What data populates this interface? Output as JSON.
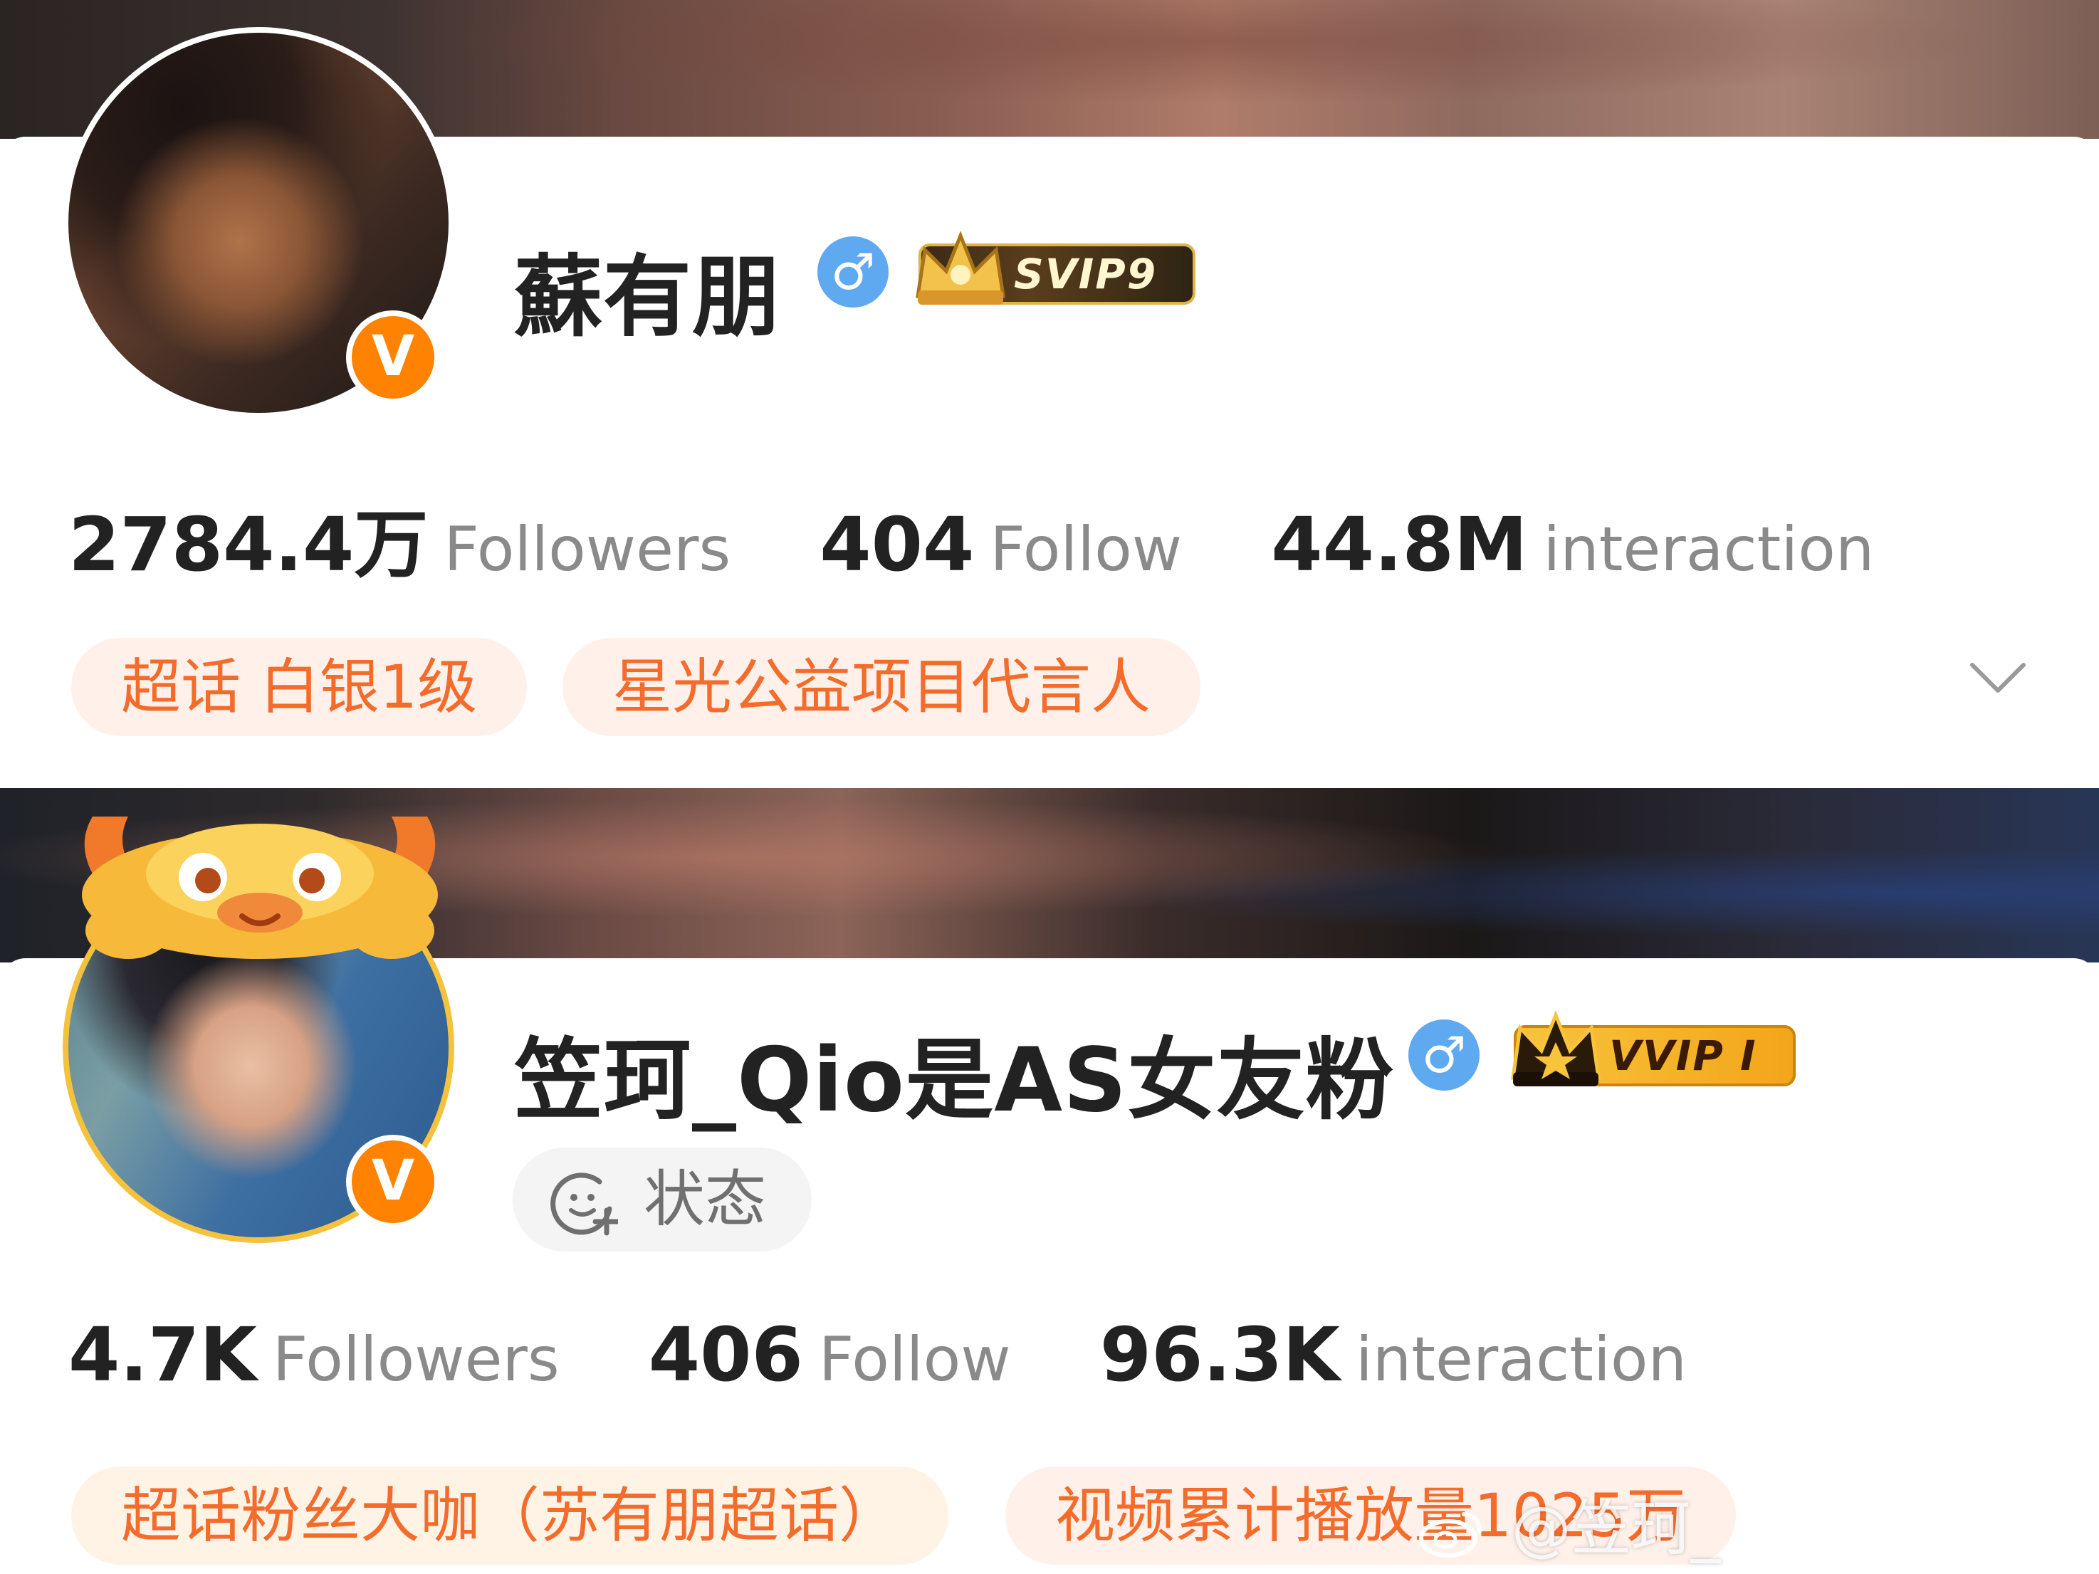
{
  "profiles": [
    {
      "name": "蘇有朋",
      "gender_symbol": "♂",
      "vip_label": "SVIP9",
      "verified_badge": "V",
      "stats": [
        {
          "value": "2784.4万",
          "label": "Followers"
        },
        {
          "value": "404",
          "label": "Follow"
        },
        {
          "value": "44.8M",
          "label": "interaction"
        }
      ],
      "tags": [
        "超话 白银1级",
        "星光公益项目代言人"
      ]
    },
    {
      "name": "笠珂_Qio是AS女友粉",
      "gender_symbol": "♂",
      "vip_label": "VVIP I",
      "verified_badge": "V",
      "status_label": "状态",
      "stats": [
        {
          "value": "4.7K",
          "label": "Followers"
        },
        {
          "value": "406",
          "label": "Follow"
        },
        {
          "value": "96.3K",
          "label": "interaction"
        }
      ],
      "tags": [
        "超话粉丝大咖（苏有朋超话）",
        "视频累计播放量1025万"
      ]
    }
  ],
  "watermark": "@笠珂_",
  "icons": [
    "chevron-down-icon",
    "status-add-icon",
    "crown-icon",
    "weibo-logo-icon",
    "verified-v-icon",
    "gender-male-icon"
  ],
  "colors": {
    "accent": "#ff8200",
    "tag_text": "#f36c2c",
    "tag_bg": "#fff1ea",
    "gender_blue": "#5fa9f0"
  }
}
